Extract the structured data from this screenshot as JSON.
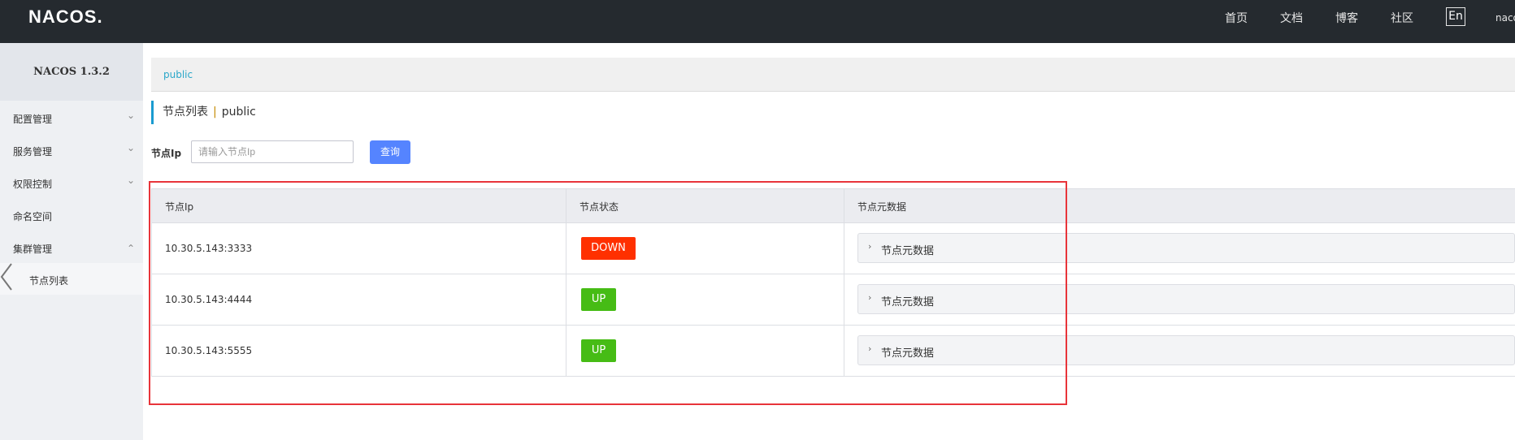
{
  "header": {
    "logo": "NACOS.",
    "nav": [
      "首页",
      "文档",
      "博客",
      "社区"
    ],
    "lang_button": "En",
    "user": "nacos"
  },
  "sidebar": {
    "version": "NACOS 1.3.2",
    "items": [
      {
        "label": "配置管理",
        "chevron": "down"
      },
      {
        "label": "服务管理",
        "chevron": "down"
      },
      {
        "label": "权限控制",
        "chevron": "down"
      },
      {
        "label": "命名空间",
        "chevron": ""
      },
      {
        "label": "集群管理",
        "chevron": "up"
      }
    ],
    "subitem": "节点列表"
  },
  "breadcrumb": "public",
  "page": {
    "title": "节点列表",
    "separator": "|",
    "namespace": "public"
  },
  "filter": {
    "label": "节点Ip",
    "placeholder": "请输入节点Ip",
    "query_button": "查询"
  },
  "table": {
    "columns": [
      "节点Ip",
      "节点状态",
      "节点元数据"
    ],
    "rows": [
      {
        "ip": "10.30.5.143:3333",
        "status": "DOWN",
        "meta": "节点元数据"
      },
      {
        "ip": "10.30.5.143:4444",
        "status": "UP",
        "meta": "节点元数据"
      },
      {
        "ip": "10.30.5.143:5555",
        "status": "UP",
        "meta": "节点元数据"
      }
    ]
  },
  "colors": {
    "topbar": "#252a2f",
    "accent": "#5584ff",
    "status_down": "#ff3000",
    "status_up": "#46bc15",
    "highlight": "#e8343a"
  }
}
